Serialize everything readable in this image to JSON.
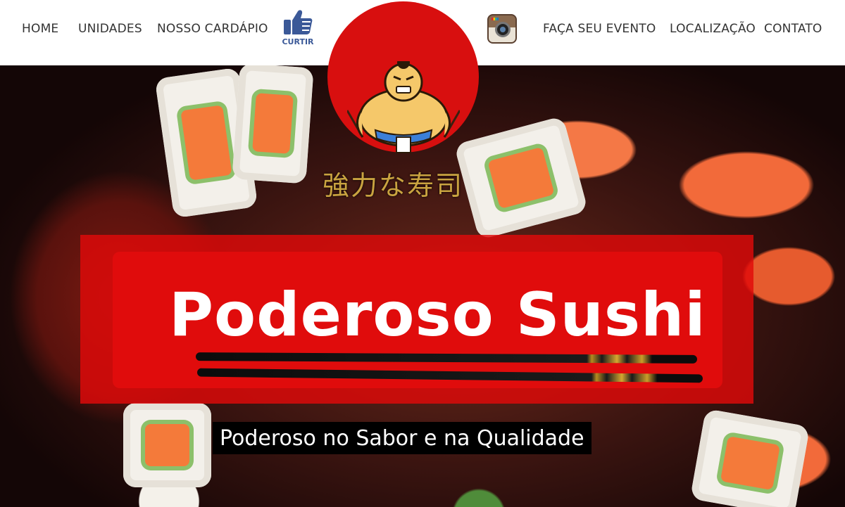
{
  "nav": {
    "home": "HOME",
    "unidades": "UNIDADES",
    "cardapio": "NOSSO CARDÁPIO",
    "like_label": "CURTIR",
    "evento": "FAÇA SEU EVENTO",
    "localizacao": "LOCALIZAÇÃO",
    "contato": "CONTATO"
  },
  "logo": {
    "kanji": "強力な寿司"
  },
  "hero": {
    "brand": "Poderoso Sushi",
    "tagline": "Poderoso no Sabor e na Qualidade"
  },
  "colors": {
    "brand_red": "#e00c0c",
    "logo_red": "#d80f0f",
    "facebook_blue": "#3b5998"
  },
  "icons": {
    "like": "thumbs-up-icon",
    "instagram": "instagram-icon"
  }
}
